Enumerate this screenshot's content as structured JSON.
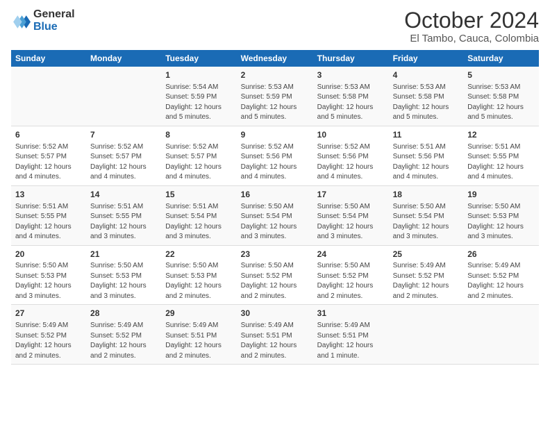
{
  "logo": {
    "general": "General",
    "blue": "Blue"
  },
  "title": "October 2024",
  "subtitle": "El Tambo, Cauca, Colombia",
  "headers": [
    "Sunday",
    "Monday",
    "Tuesday",
    "Wednesday",
    "Thursday",
    "Friday",
    "Saturday"
  ],
  "weeks": [
    [
      {
        "day": "",
        "text": ""
      },
      {
        "day": "",
        "text": ""
      },
      {
        "day": "1",
        "text": "Sunrise: 5:54 AM\nSunset: 5:59 PM\nDaylight: 12 hours and 5 minutes."
      },
      {
        "day": "2",
        "text": "Sunrise: 5:53 AM\nSunset: 5:59 PM\nDaylight: 12 hours and 5 minutes."
      },
      {
        "day": "3",
        "text": "Sunrise: 5:53 AM\nSunset: 5:58 PM\nDaylight: 12 hours and 5 minutes."
      },
      {
        "day": "4",
        "text": "Sunrise: 5:53 AM\nSunset: 5:58 PM\nDaylight: 12 hours and 5 minutes."
      },
      {
        "day": "5",
        "text": "Sunrise: 5:53 AM\nSunset: 5:58 PM\nDaylight: 12 hours and 5 minutes."
      }
    ],
    [
      {
        "day": "6",
        "text": "Sunrise: 5:52 AM\nSunset: 5:57 PM\nDaylight: 12 hours and 4 minutes."
      },
      {
        "day": "7",
        "text": "Sunrise: 5:52 AM\nSunset: 5:57 PM\nDaylight: 12 hours and 4 minutes."
      },
      {
        "day": "8",
        "text": "Sunrise: 5:52 AM\nSunset: 5:57 PM\nDaylight: 12 hours and 4 minutes."
      },
      {
        "day": "9",
        "text": "Sunrise: 5:52 AM\nSunset: 5:56 PM\nDaylight: 12 hours and 4 minutes."
      },
      {
        "day": "10",
        "text": "Sunrise: 5:52 AM\nSunset: 5:56 PM\nDaylight: 12 hours and 4 minutes."
      },
      {
        "day": "11",
        "text": "Sunrise: 5:51 AM\nSunset: 5:56 PM\nDaylight: 12 hours and 4 minutes."
      },
      {
        "day": "12",
        "text": "Sunrise: 5:51 AM\nSunset: 5:55 PM\nDaylight: 12 hours and 4 minutes."
      }
    ],
    [
      {
        "day": "13",
        "text": "Sunrise: 5:51 AM\nSunset: 5:55 PM\nDaylight: 12 hours and 4 minutes."
      },
      {
        "day": "14",
        "text": "Sunrise: 5:51 AM\nSunset: 5:55 PM\nDaylight: 12 hours and 3 minutes."
      },
      {
        "day": "15",
        "text": "Sunrise: 5:51 AM\nSunset: 5:54 PM\nDaylight: 12 hours and 3 minutes."
      },
      {
        "day": "16",
        "text": "Sunrise: 5:50 AM\nSunset: 5:54 PM\nDaylight: 12 hours and 3 minutes."
      },
      {
        "day": "17",
        "text": "Sunrise: 5:50 AM\nSunset: 5:54 PM\nDaylight: 12 hours and 3 minutes."
      },
      {
        "day": "18",
        "text": "Sunrise: 5:50 AM\nSunset: 5:54 PM\nDaylight: 12 hours and 3 minutes."
      },
      {
        "day": "19",
        "text": "Sunrise: 5:50 AM\nSunset: 5:53 PM\nDaylight: 12 hours and 3 minutes."
      }
    ],
    [
      {
        "day": "20",
        "text": "Sunrise: 5:50 AM\nSunset: 5:53 PM\nDaylight: 12 hours and 3 minutes."
      },
      {
        "day": "21",
        "text": "Sunrise: 5:50 AM\nSunset: 5:53 PM\nDaylight: 12 hours and 3 minutes."
      },
      {
        "day": "22",
        "text": "Sunrise: 5:50 AM\nSunset: 5:53 PM\nDaylight: 12 hours and 2 minutes."
      },
      {
        "day": "23",
        "text": "Sunrise: 5:50 AM\nSunset: 5:52 PM\nDaylight: 12 hours and 2 minutes."
      },
      {
        "day": "24",
        "text": "Sunrise: 5:50 AM\nSunset: 5:52 PM\nDaylight: 12 hours and 2 minutes."
      },
      {
        "day": "25",
        "text": "Sunrise: 5:49 AM\nSunset: 5:52 PM\nDaylight: 12 hours and 2 minutes."
      },
      {
        "day": "26",
        "text": "Sunrise: 5:49 AM\nSunset: 5:52 PM\nDaylight: 12 hours and 2 minutes."
      }
    ],
    [
      {
        "day": "27",
        "text": "Sunrise: 5:49 AM\nSunset: 5:52 PM\nDaylight: 12 hours and 2 minutes."
      },
      {
        "day": "28",
        "text": "Sunrise: 5:49 AM\nSunset: 5:52 PM\nDaylight: 12 hours and 2 minutes."
      },
      {
        "day": "29",
        "text": "Sunrise: 5:49 AM\nSunset: 5:51 PM\nDaylight: 12 hours and 2 minutes."
      },
      {
        "day": "30",
        "text": "Sunrise: 5:49 AM\nSunset: 5:51 PM\nDaylight: 12 hours and 2 minutes."
      },
      {
        "day": "31",
        "text": "Sunrise: 5:49 AM\nSunset: 5:51 PM\nDaylight: 12 hours and 1 minute."
      },
      {
        "day": "",
        "text": ""
      },
      {
        "day": "",
        "text": ""
      }
    ]
  ]
}
